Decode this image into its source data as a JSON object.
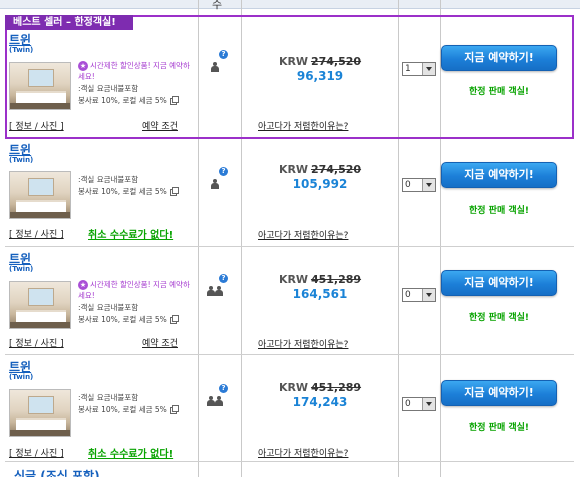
{
  "header": {
    "col_occupancy": "수",
    "col_price": "",
    "col_qty": ""
  },
  "featured_badge": "베스트 셀러 – 한정객실!",
  "rows": [
    {
      "room_name": "트윈",
      "room_sub": "(Twin)",
      "promo": "시간제한 할인상품! 지금 예약하세요!",
      "inclusion_1": ":객실 요금내불포함",
      "inclusion_2": "봉사료 10%, 로컬 세금 5%",
      "info_link": "[ 정보 / 사진 ]",
      "secondary_link": "예약 조건",
      "secondary_type": "condition",
      "occupancy_icon": "single-person-icon",
      "currency": "KRW",
      "old_price": "274,520",
      "new_price": "96,319",
      "why_link": "아고다가 저렴한이유는?",
      "qty": "1",
      "book_label": "지금 예약하기!",
      "limited_label": "한정 판매 객실!"
    },
    {
      "room_name": "트윈",
      "room_sub": "(Twin)",
      "promo": "",
      "inclusion_1": ":객실 요금내불포함",
      "inclusion_2": "봉사료 10%, 로컬 세금 5%",
      "info_link": "[ 정보 / 사진 ]",
      "secondary_link": "취소 수수료가 없다!",
      "secondary_type": "free",
      "occupancy_icon": "single-person-icon",
      "currency": "KRW",
      "old_price": "274,520",
      "new_price": "105,992",
      "why_link": "아고다가 저렴한이유는?",
      "qty": "0",
      "book_label": "지금 예약하기!",
      "limited_label": "한정 판매 객실!"
    },
    {
      "room_name": "트윈",
      "room_sub": "(Twin)",
      "promo": "시간제한 할인상품! 지금 예약하세요!",
      "inclusion_1": ":객실 요금내불포함",
      "inclusion_2": "봉사료 10%, 로컬 세금 5%",
      "info_link": "[ 정보 / 사진 ]",
      "secondary_link": "예약 조건",
      "secondary_type": "condition",
      "occupancy_icon": "two-persons-icon",
      "currency": "KRW",
      "old_price": "451,289",
      "new_price": "164,561",
      "why_link": "아고다가 저렴한이유는?",
      "qty": "0",
      "book_label": "지금 예약하기!",
      "limited_label": "한정 판매 객실!"
    },
    {
      "room_name": "트윈",
      "room_sub": "(Twin)",
      "promo": "",
      "inclusion_1": ":객실 요금내불포함",
      "inclusion_2": "봉사료 10%, 로컬 세금 5%",
      "info_link": "[ 정보 / 사진 ]",
      "secondary_link": "취소 수수료가 없다!",
      "secondary_type": "free",
      "occupancy_icon": "two-persons-icon",
      "currency": "KRW",
      "old_price": "451,289",
      "new_price": "174,243",
      "why_link": "아고다가 저렴한이유는?",
      "qty": "0",
      "book_label": "지금 예약하기!",
      "limited_label": "한정 판매 객실!"
    }
  ],
  "next_room_name": "싱글 (조식 포함)",
  "colors": {
    "featured_border": "#9b30c9",
    "book_button": "#1c7fd8",
    "new_price": "#1a83d6",
    "free_cancel": "#08a300"
  }
}
